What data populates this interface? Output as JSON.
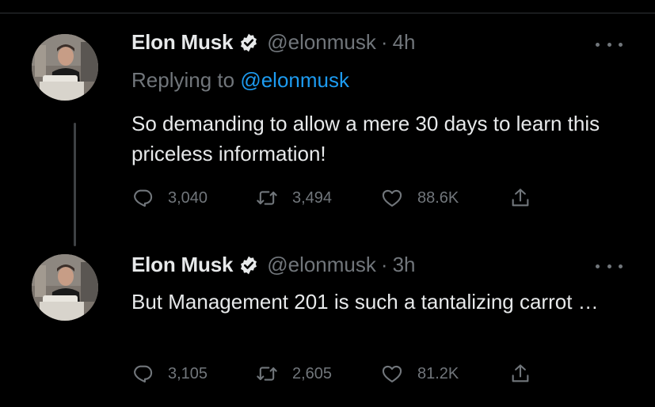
{
  "colors": {
    "background": "#000000",
    "text": "#e7e9ea",
    "muted": "#71767b",
    "link": "#1d9bf0",
    "verified_badge": "#e7e9ea"
  },
  "tweets": [
    {
      "name": "Elon Musk",
      "handle": "@elonmusk",
      "separator": "·",
      "time": "4h",
      "reply_prefix": "Replying to",
      "reply_to": "@elonmusk",
      "text": "So demanding to allow a mere 30 days to learn this priceless information!",
      "replies": "3,040",
      "retweets": "3,494",
      "likes": "88.6K"
    },
    {
      "name": "Elon Musk",
      "handle": "@elonmusk",
      "separator": "·",
      "time": "3h",
      "text": "But Management 201 is such a tantalizing carrot …",
      "replies": "3,105",
      "retweets": "2,605",
      "likes": "81.2K"
    }
  ],
  "icons": {
    "verified": "verified-badge-icon",
    "more": "more-horizontal-icon",
    "reply": "reply-bubble-icon",
    "retweet": "retweet-icon",
    "like": "heart-icon",
    "share": "share-upload-icon"
  }
}
